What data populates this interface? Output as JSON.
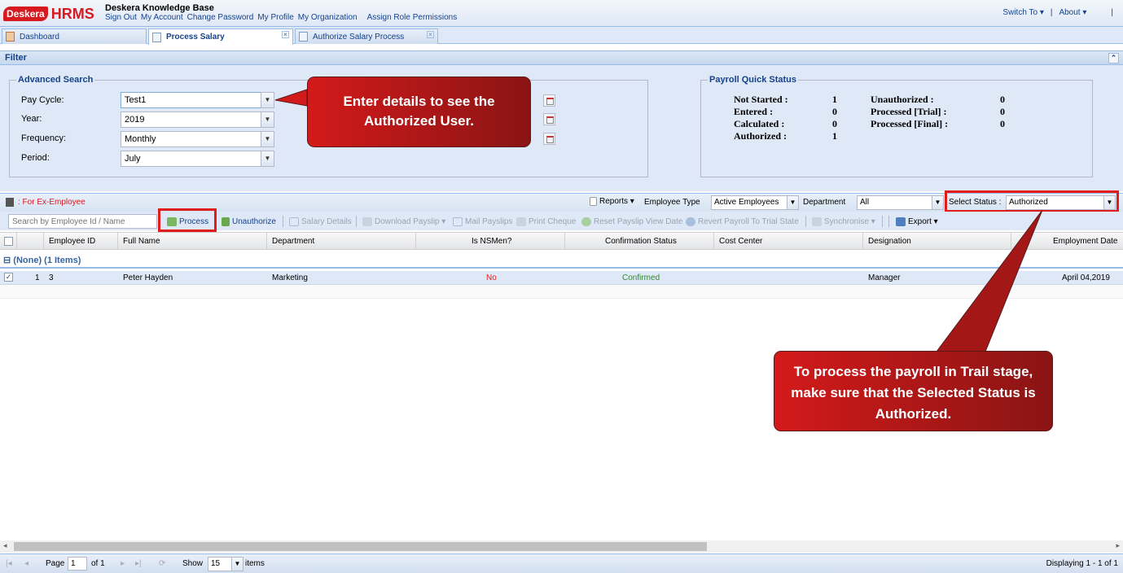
{
  "header": {
    "logo_mark": "Desk",
    "logo_mark_rest": "era",
    "logo_product": "HRMS",
    "kb_title": "Deskera Knowledge Base",
    "links": [
      "Sign Out",
      "My Account",
      "Change Password",
      "My Profile",
      "My Organization",
      "Assign Role Permissions"
    ],
    "switch_to": "Switch To ▾",
    "separator": "|",
    "about": "About ▾",
    "end_bar": "|"
  },
  "tabs": [
    {
      "label": "Dashboard"
    },
    {
      "label": "Process Salary"
    },
    {
      "label": "Authorize Salary Process"
    }
  ],
  "filter": {
    "title": "Filter",
    "advanced_search": {
      "legend": "Advanced Search",
      "pay_cycle_label": "Pay Cycle:",
      "pay_cycle_value": "Test1",
      "year_label": "Year:",
      "year_value": "2019",
      "frequency_label": "Frequency:",
      "frequency_value": "Monthly",
      "period_label": "Period:",
      "period_value": "July"
    },
    "quick_status": {
      "legend": "Payroll Quick Status",
      "not_started_label": "Not Started :",
      "not_started": "1",
      "entered_label": "Entered :",
      "entered": "0",
      "calculated_label": "Calculated :",
      "calculated": "0",
      "authorized_label": "Authorized :",
      "authorized": "1",
      "unauthorized_label": "Unauthorized :",
      "unauthorized": "0",
      "processed_trial_label": "Processed [Trial] :",
      "processed_trial": "0",
      "processed_final_label": "Processed [Final] :",
      "processed_final": "0"
    }
  },
  "callouts": {
    "first": "Enter details to see the Authorized User.",
    "second": "To process the payroll in Trail stage, make sure that the Selected Status is Authorized."
  },
  "grid_toolbar": {
    "ex_employee": ": For Ex-Employee",
    "reports": "Reports ▾",
    "employee_type_label": "Employee Type",
    "employee_type_value": "Active Employees",
    "department_label": "Department",
    "department_value": "All",
    "select_status_label": "Select Status :",
    "select_status_value": "Authorized"
  },
  "actions": {
    "search_placeholder": "Search by Employee Id / Name",
    "process": "Process",
    "unauthorize": "Unauthorize",
    "salary_details": "Salary Details",
    "download_payslip": "Download Payslip ▾",
    "mail_payslips": "Mail Payslips",
    "print_cheque": "Print Cheque",
    "reset_payslip": "Reset Payslip View Date",
    "revert_payroll": "Revert Payroll To Trial State",
    "synchronise": "Synchronise ▾",
    "export": "Export ▾"
  },
  "grid": {
    "columns": [
      "Employee ID",
      "Full Name",
      "Department",
      "Is NSMen?",
      "Confirmation Status",
      "Cost Center",
      "Designation",
      "Employment Date"
    ],
    "group_label": "(None) (1 Items)",
    "rows": [
      {
        "num": "1",
        "employee_id": "3",
        "full_name": "Peter Hayden",
        "department": "Marketing",
        "is_nsmen": "No",
        "confirmation": "Confirmed",
        "cost_center": "",
        "designation": "Manager",
        "employment_date": "April 04,2019"
      }
    ]
  },
  "pager": {
    "page_label": "Page",
    "page_value": "1",
    "of_label": "of 1",
    "show_label": "Show",
    "show_value": "15",
    "items_label": "items",
    "displaying": "Displaying 1 - 1 of 1"
  },
  "colors": {
    "brand_red": "#d71920",
    "highlight_red": "#e21b1b",
    "panel_blue": "#dfe8f6"
  }
}
